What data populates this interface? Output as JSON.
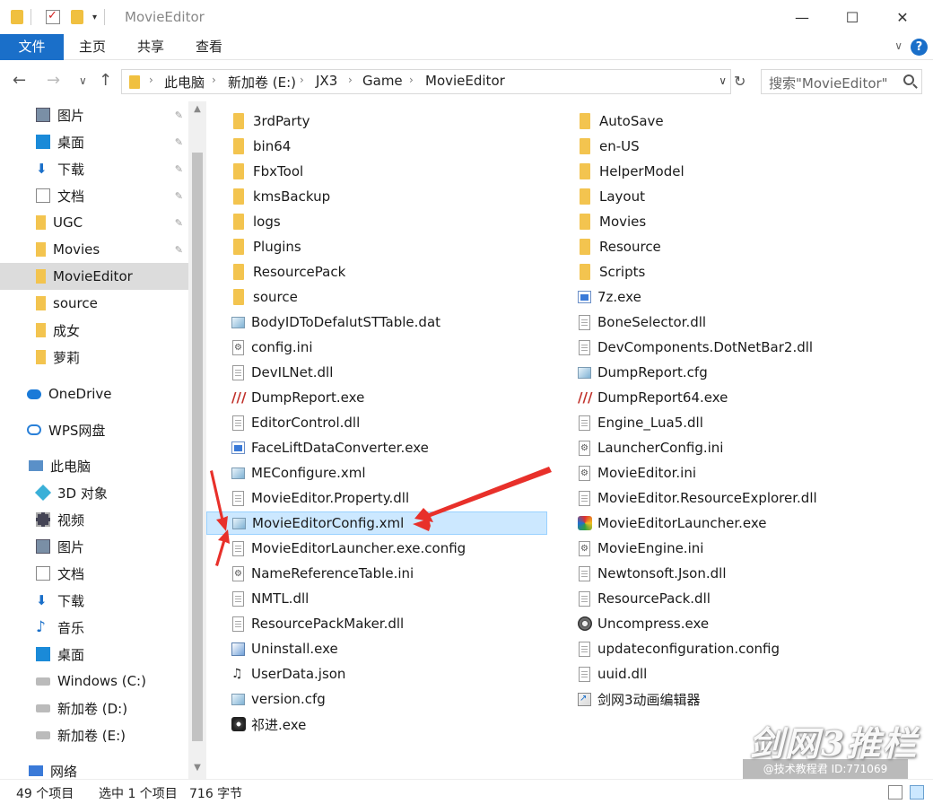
{
  "window": {
    "title": "MovieEditor",
    "minimize": "—",
    "maximize": "☐",
    "close": "✕"
  },
  "ribbon": {
    "tabs": [
      "文件",
      "主页",
      "共享",
      "查看"
    ],
    "collapse": "∨",
    "help": "?"
  },
  "nav": {
    "back": "←",
    "forward": "→",
    "recent": "∨",
    "up": "↑",
    "breadcrumbs": [
      "此电脑",
      "新加卷 (E:)",
      "JX3",
      "Game",
      "MovieEditor"
    ],
    "separator": "›",
    "refresh": "↻",
    "search_placeholder": "搜索\"MovieEditor\""
  },
  "sidebar": {
    "items": [
      {
        "label": "图片",
        "icon": "pictures-icon",
        "pinned": true
      },
      {
        "label": "桌面",
        "icon": "desktop-icon",
        "pinned": true
      },
      {
        "label": "下载",
        "icon": "download-icon",
        "pinned": true
      },
      {
        "label": "文档",
        "icon": "documents-icon",
        "pinned": true
      },
      {
        "label": "UGC",
        "icon": "folder-icon",
        "pinned": true
      },
      {
        "label": "Movies",
        "icon": "folder-icon",
        "pinned": true
      },
      {
        "label": "MovieEditor",
        "icon": "folder-icon",
        "pinned": false,
        "selected": true
      },
      {
        "label": "source",
        "icon": "folder-icon",
        "pinned": false
      },
      {
        "label": "成女",
        "icon": "folder-icon",
        "pinned": false
      },
      {
        "label": "萝莉",
        "icon": "folder-icon",
        "pinned": false
      },
      {
        "label": "OneDrive",
        "icon": "onedrive-icon",
        "pinned": false
      },
      {
        "label": "WPS网盘",
        "icon": "wps-cloud-icon",
        "pinned": false
      },
      {
        "label": "此电脑",
        "icon": "this-pc-icon",
        "pinned": false
      },
      {
        "label": "3D 对象",
        "icon": "3d-objects-icon",
        "pinned": false
      },
      {
        "label": "视频",
        "icon": "videos-icon",
        "pinned": false
      },
      {
        "label": "图片",
        "icon": "pictures-icon",
        "pinned": false
      },
      {
        "label": "文档",
        "icon": "documents-icon",
        "pinned": false
      },
      {
        "label": "下载",
        "icon": "download-icon",
        "pinned": false
      },
      {
        "label": "音乐",
        "icon": "music-icon",
        "pinned": false
      },
      {
        "label": "桌面",
        "icon": "desktop-icon",
        "pinned": false
      },
      {
        "label": "Windows (C:)",
        "icon": "drive-icon",
        "pinned": false
      },
      {
        "label": "新加卷 (D:)",
        "icon": "drive-icon",
        "pinned": false
      },
      {
        "label": "新加卷 (E:)",
        "icon": "drive-icon",
        "pinned": false
      },
      {
        "label": "网络",
        "icon": "network-icon",
        "pinned": false
      }
    ],
    "pin_glyph": "📌",
    "scroll_up": "▲",
    "scroll_down": "▼"
  },
  "files": {
    "left": [
      {
        "name": "3rdParty",
        "type": "folder"
      },
      {
        "name": "bin64",
        "type": "folder"
      },
      {
        "name": "FbxTool",
        "type": "folder"
      },
      {
        "name": "kmsBackup",
        "type": "folder"
      },
      {
        "name": "logs",
        "type": "folder"
      },
      {
        "name": "Plugins",
        "type": "folder"
      },
      {
        "name": "ResourcePack",
        "type": "folder"
      },
      {
        "name": "source",
        "type": "folder"
      },
      {
        "name": "BodyIDToDefalutSTTable.dat",
        "type": "xml"
      },
      {
        "name": "config.ini",
        "type": "gear"
      },
      {
        "name": "DevILNet.dll",
        "type": "doc"
      },
      {
        "name": "DumpReport.exe",
        "type": "claw"
      },
      {
        "name": "EditorControl.dll",
        "type": "doc"
      },
      {
        "name": "FaceLiftDataConverter.exe",
        "type": "exe"
      },
      {
        "name": "MEConfigure.xml",
        "type": "xml"
      },
      {
        "name": "MovieEditor.Property.dll",
        "type": "doc"
      },
      {
        "name": "MovieEditorConfig.xml",
        "type": "xml",
        "selected": true
      },
      {
        "name": "MovieEditorLauncher.exe.config",
        "type": "doc"
      },
      {
        "name": "NameReferenceTable.ini",
        "type": "gear"
      },
      {
        "name": "NMTL.dll",
        "type": "doc"
      },
      {
        "name": "ResourcePackMaker.dll",
        "type": "doc"
      },
      {
        "name": "Uninstall.exe",
        "type": "setup"
      },
      {
        "name": "UserData.json",
        "type": "json"
      },
      {
        "name": "version.cfg",
        "type": "xml"
      },
      {
        "name": "祁进.exe",
        "type": "app"
      }
    ],
    "right": [
      {
        "name": "AutoSave",
        "type": "folder"
      },
      {
        "name": "en-US",
        "type": "folder"
      },
      {
        "name": "HelperModel",
        "type": "folder"
      },
      {
        "name": "Layout",
        "type": "folder"
      },
      {
        "name": "Movies",
        "type": "folder"
      },
      {
        "name": "Resource",
        "type": "folder"
      },
      {
        "name": "Scripts",
        "type": "folder"
      },
      {
        "name": "7z.exe",
        "type": "exe"
      },
      {
        "name": "BoneSelector.dll",
        "type": "doc"
      },
      {
        "name": "DevComponents.DotNetBar2.dll",
        "type": "doc"
      },
      {
        "name": "DumpReport.cfg",
        "type": "xml"
      },
      {
        "name": "DumpReport64.exe",
        "type": "claw"
      },
      {
        "name": "Engine_Lua5.dll",
        "type": "doc"
      },
      {
        "name": "LauncherConfig.ini",
        "type": "gear"
      },
      {
        "name": "MovieEditor.ini",
        "type": "gear"
      },
      {
        "name": "MovieEditor.ResourceExplorer.dll",
        "type": "doc"
      },
      {
        "name": "MovieEditorLauncher.exe",
        "type": "launcher"
      },
      {
        "name": "MovieEngine.ini",
        "type": "gear"
      },
      {
        "name": "Newtonsoft.Json.dll",
        "type": "doc"
      },
      {
        "name": "ResourcePack.dll",
        "type": "doc"
      },
      {
        "name": "Uncompress.exe",
        "type": "reel"
      },
      {
        "name": "updateconfiguration.config",
        "type": "doc"
      },
      {
        "name": "uuid.dll",
        "type": "doc"
      },
      {
        "name": "剑网3动画编辑器",
        "type": "link"
      }
    ]
  },
  "status": {
    "count": "49 个项目",
    "selection": "选中 1 个项目",
    "size": "716 字节"
  },
  "watermark": {
    "logo": "剑网3推栏",
    "tag": "@技术教程君 ID:771069"
  },
  "colors": {
    "accent": "#1a6fc9",
    "selection": "#cce8ff",
    "arrow": "#e8302a",
    "folder": "#f3c44f"
  }
}
